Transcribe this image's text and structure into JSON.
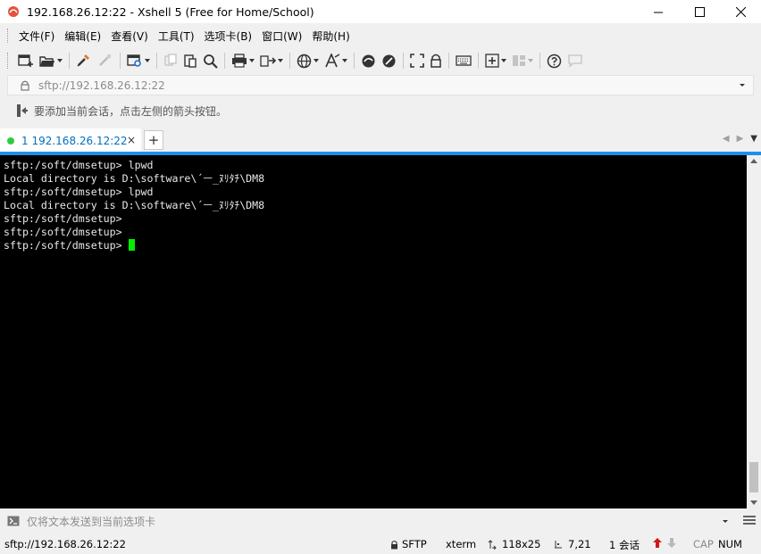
{
  "window": {
    "title": "192.168.26.12:22 - Xshell 5 (Free for Home/School)",
    "minimize_glyph": "—",
    "maximize_glyph": "☐",
    "close_glyph": "✕"
  },
  "menu": [
    "文件(F)",
    "编辑(E)",
    "查看(V)",
    "工具(T)",
    "选项卡(B)",
    "窗口(W)",
    "帮助(H)"
  ],
  "toolbar": {
    "icons": [
      "new-session-icon",
      "open-folder-icon",
      "connect-icon",
      "disconnect-icon",
      "properties-icon",
      "copy-icon",
      "paste-icon",
      "find-icon",
      "print-icon",
      "transfer-icon",
      "globe-icon",
      "font-icon",
      "xftp-icon",
      "xmanager-icon",
      "fullscreen-icon",
      "lock-icon",
      "keyboard-icon",
      "add-compose-icon",
      "layout-icon",
      "help-icon",
      "chat-icon"
    ]
  },
  "address": {
    "value": "sftp://192.168.26.12:22",
    "icon": "lock-icon"
  },
  "hint": {
    "text": "要添加当前会话，点击左侧的箭头按钮。"
  },
  "tabs": [
    {
      "label": "1 192.168.26.12:22",
      "close": "×",
      "status_color": "#2ecc40"
    }
  ],
  "tab_add": "+",
  "terminal": {
    "lines": [
      "sftp:/soft/dmsetup> lpwd",
      "Local directory is D:\\software\\´ￚ_ﾇﾘﾀﾁ\\DM8",
      "sftp:/soft/dmsetup> lpwd",
      "Local directory is D:\\software\\´ￚ_ﾇﾘﾀﾁ\\DM8",
      "sftp:/soft/dmsetup>",
      "sftp:/soft/dmsetup>",
      "sftp:/soft/dmsetup> "
    ],
    "cursor_color": "#00ee00"
  },
  "compose": {
    "placeholder": "仅将文本发送到当前选项卡"
  },
  "status": {
    "connection": "sftp://192.168.26.12:22",
    "protocol": "SFTP",
    "terminal_type": "xterm",
    "size": "118x25",
    "cursor_pos": "7,21",
    "sessions": "1 会话",
    "cap": "CAP",
    "num": "NUM"
  },
  "colors": {
    "accent": "#1f8fe6",
    "tab_text": "#0070c0",
    "terminal_bg": "#000000",
    "terminal_fg": "#e8e8e8"
  }
}
